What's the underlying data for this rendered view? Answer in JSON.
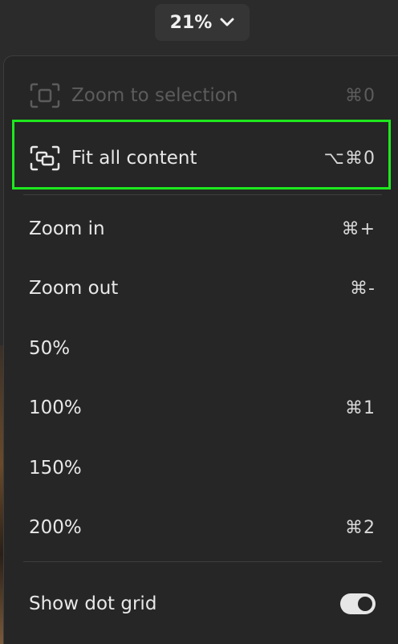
{
  "zoom_control": {
    "value": "21%",
    "icon": "chevron-down-icon"
  },
  "menu": {
    "zoom_to_selection": {
      "label": "Zoom to selection",
      "shortcut": "⌘0",
      "enabled": false,
      "icon": "zoom-to-selection-icon"
    },
    "fit_all_content": {
      "label": "Fit all content",
      "shortcut": "⌥⌘0",
      "enabled": true,
      "icon": "fit-all-content-icon",
      "highlighted": true
    },
    "zoom_in": {
      "label": "Zoom in",
      "shortcut": "⌘+"
    },
    "zoom_out": {
      "label": "Zoom out",
      "shortcut": "⌘-"
    },
    "zoom_50": {
      "label": "50%"
    },
    "zoom_100": {
      "label": "100%",
      "shortcut": "⌘1"
    },
    "zoom_150": {
      "label": "150%"
    },
    "zoom_200": {
      "label": "200%",
      "shortcut": "⌘2"
    },
    "show_dot_grid": {
      "label": "Show dot grid",
      "on": true
    }
  },
  "colors": {
    "highlight": "#1ee81e",
    "menu_bg": "#262626",
    "text": "#e8e8e8",
    "disabled_text": "#5c5c5c"
  }
}
